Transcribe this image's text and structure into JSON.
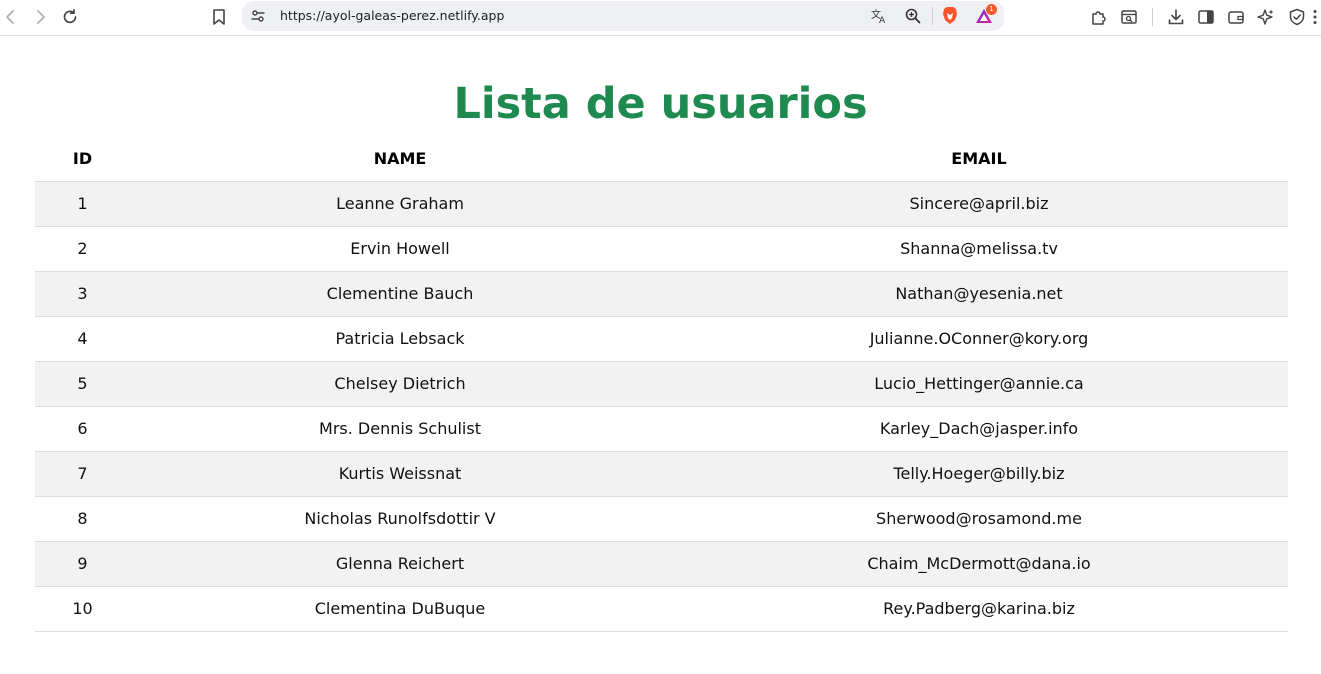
{
  "browser": {
    "url": "https://ayol-galeas-perez.netlify.app",
    "extension_badge": "1",
    "icons": {
      "back": "back-arrow-icon",
      "forward": "forward-arrow-icon",
      "reload": "reload-icon",
      "bookmark": "bookmark-icon",
      "site_info": "site-settings-icon",
      "translate": "translate-icon",
      "zoom": "zoom-icon",
      "brave_shields": "brave-lion-icon",
      "brave_rewards": "brave-rewards-icon",
      "extensions": "puzzle-icon",
      "tab_search": "tab-search-icon",
      "downloads": "download-icon",
      "sidebar": "sidebar-icon",
      "wallet": "wallet-icon",
      "leo": "leo-ai-icon",
      "vpn": "shield-icon",
      "menu": "menu-icon"
    }
  },
  "colors": {
    "title": "#1e8a50",
    "striped_row": "#f2f2f2",
    "row_border": "#dcdcdc"
  },
  "page": {
    "title": "Lista de usuarios"
  },
  "table": {
    "headers": {
      "id": "ID",
      "name": "NAME",
      "email": "EMAIL"
    },
    "rows": [
      {
        "id": "1",
        "name": "Leanne Graham",
        "email": "Sincere@april.biz"
      },
      {
        "id": "2",
        "name": "Ervin Howell",
        "email": "Shanna@melissa.tv"
      },
      {
        "id": "3",
        "name": "Clementine Bauch",
        "email": "Nathan@yesenia.net"
      },
      {
        "id": "4",
        "name": "Patricia Lebsack",
        "email": "Julianne.OConner@kory.org"
      },
      {
        "id": "5",
        "name": "Chelsey Dietrich",
        "email": "Lucio_Hettinger@annie.ca"
      },
      {
        "id": "6",
        "name": "Mrs. Dennis Schulist",
        "email": "Karley_Dach@jasper.info"
      },
      {
        "id": "7",
        "name": "Kurtis Weissnat",
        "email": "Telly.Hoeger@billy.biz"
      },
      {
        "id": "8",
        "name": "Nicholas Runolfsdottir V",
        "email": "Sherwood@rosamond.me"
      },
      {
        "id": "9",
        "name": "Glenna Reichert",
        "email": "Chaim_McDermott@dana.io"
      },
      {
        "id": "10",
        "name": "Clementina DuBuque",
        "email": "Rey.Padberg@karina.biz"
      }
    ]
  }
}
